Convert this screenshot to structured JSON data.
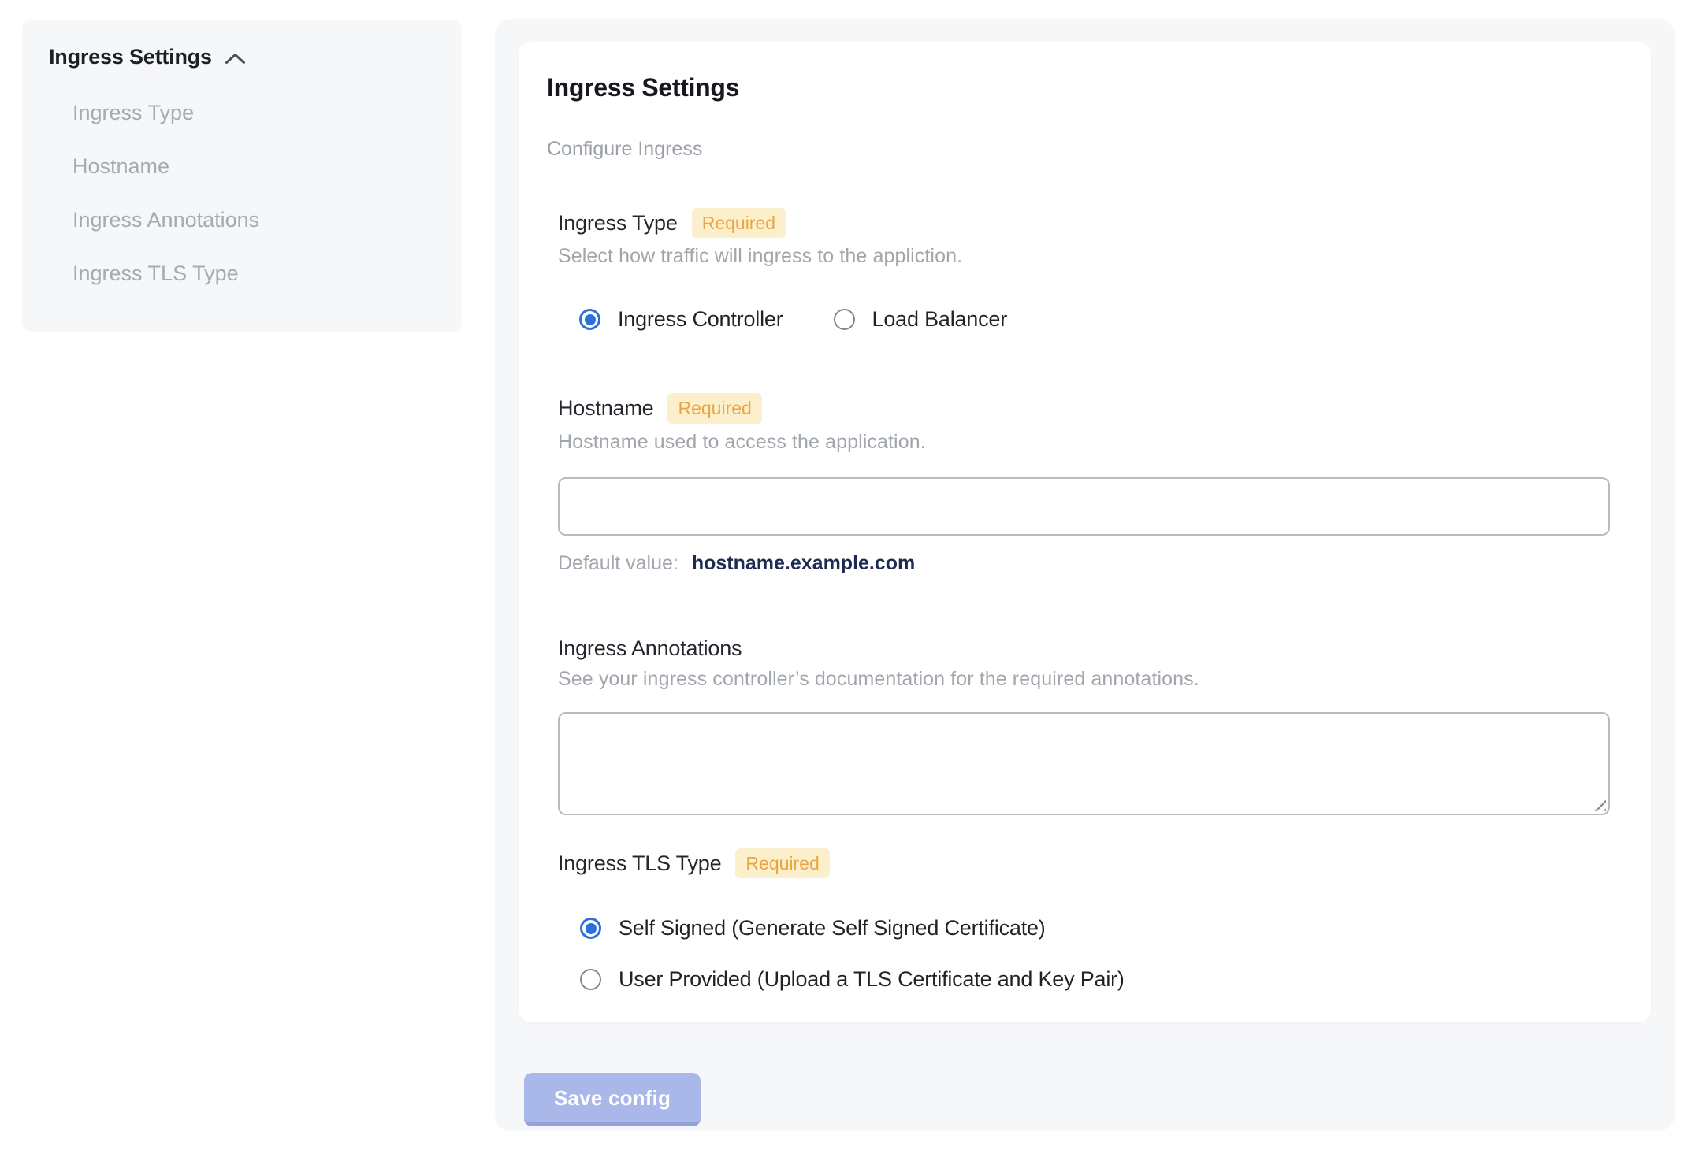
{
  "sidebar": {
    "header": "Ingress Settings",
    "items": [
      {
        "label": "Ingress Type"
      },
      {
        "label": "Hostname"
      },
      {
        "label": "Ingress Annotations"
      },
      {
        "label": "Ingress TLS Type"
      }
    ]
  },
  "panel": {
    "title": "Ingress Settings",
    "subtitle": "Configure Ingress",
    "required_badge": "Required",
    "ingress_type": {
      "label": "Ingress Type",
      "required": true,
      "help": "Select how traffic will ingress to the appliction.",
      "options": [
        {
          "label": "Ingress Controller",
          "selected": true
        },
        {
          "label": "Load Balancer",
          "selected": false
        }
      ]
    },
    "hostname": {
      "label": "Hostname",
      "required": true,
      "help": "Hostname used to access the application.",
      "value": "",
      "default_label": "Default value:",
      "default_value": "hostname.example.com"
    },
    "annotations": {
      "label": "Ingress Annotations",
      "required": false,
      "help": "See your ingress controller’s documentation for the required annotations.",
      "value": ""
    },
    "tls_type": {
      "label": "Ingress TLS Type",
      "required": true,
      "options": [
        {
          "label": "Self Signed (Generate Self Signed Certificate)",
          "selected": true
        },
        {
          "label": "User Provided (Upload a TLS Certificate and Key Pair)",
          "selected": false
        }
      ]
    },
    "save_button": "Save config"
  },
  "colors": {
    "accent_blue": "#2e6fe0",
    "badge_bg": "#fcf0cc",
    "badge_text": "#eba544",
    "save_button_bg": "#a9b8e9",
    "panel_bg": "#f6f7f9",
    "sidebar_bg": "#f6f7f9",
    "default_value_navy": "#1e2b50"
  }
}
